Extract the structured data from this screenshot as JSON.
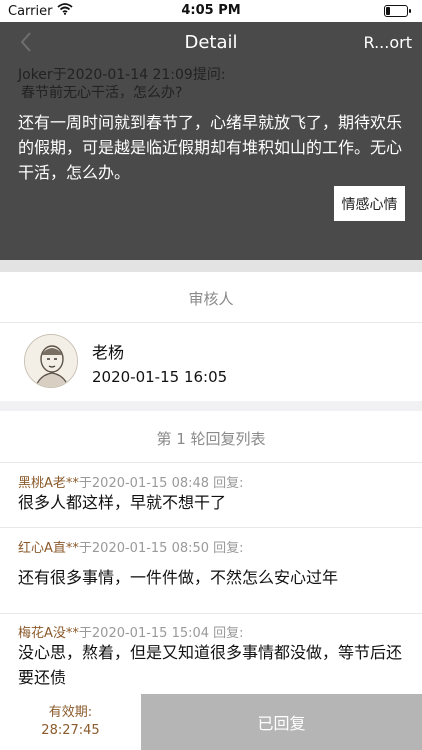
{
  "status_bar": {
    "carrier": "Carrier",
    "time": "4:05 PM",
    "battery_level": 0.2
  },
  "nav": {
    "title": "Detail",
    "report_label": "R...ort"
  },
  "question": {
    "meta_line1": "Joker于2020-01-14 21:09提问:",
    "meta_line2": "春节前无心干活，怎么办?",
    "body": "还有一周时间就到春节了，心绪早就放飞了，期待欢乐的假期，可是越是临近假期却有堆积如山的工作。无心干活，怎么办。",
    "tag": "情感心情"
  },
  "reviewer": {
    "section_title": "审核人",
    "name": "老杨",
    "time": "2020-01-15 16:05"
  },
  "replies_section": {
    "title": "第 1 轮回复列表"
  },
  "replies": [
    {
      "user": "黑桃A老**",
      "meta": "于2020-01-15 08:48 回复:",
      "text": "很多人都这样，早就不想干了"
    },
    {
      "user": "红心A直**",
      "meta": "于2020-01-15 08:50 回复:",
      "text": "还有很多事情，一件件做，不然怎么安心过年"
    },
    {
      "user": "梅花A没**",
      "meta": "于2020-01-15 15:04 回复:",
      "text": "没心思，熬着，但是又知道很多事情都没做，等节后还要还债"
    }
  ],
  "bottom": {
    "expiry_label": "有效期:",
    "expiry_value": "28:27:45",
    "replied_label": "已回复"
  }
}
